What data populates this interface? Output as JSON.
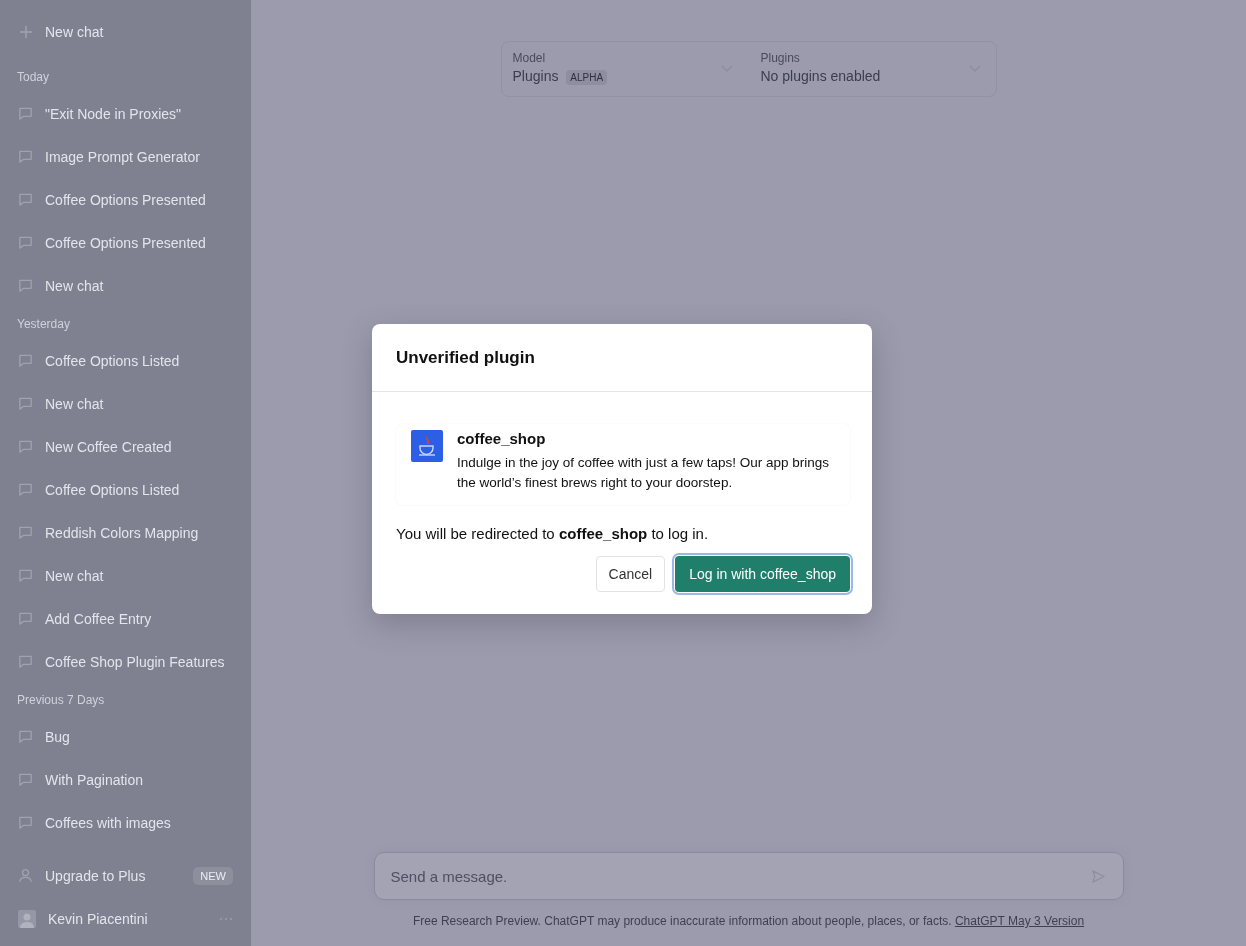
{
  "sidebar": {
    "new_chat": "New chat",
    "sections": [
      {
        "heading": "Today",
        "items": [
          {
            "title": "\"Exit Node in Proxies\""
          },
          {
            "title": "Image Prompt Generator"
          },
          {
            "title": "Coffee Options Presented"
          },
          {
            "title": "Coffee Options Presented"
          },
          {
            "title": "New chat"
          }
        ]
      },
      {
        "heading": "Yesterday",
        "items": [
          {
            "title": "Coffee Options Listed"
          },
          {
            "title": "New chat"
          },
          {
            "title": "New Coffee Created"
          },
          {
            "title": "Coffee Options Listed"
          },
          {
            "title": "Reddish Colors Mapping"
          },
          {
            "title": "New chat"
          },
          {
            "title": "Add Coffee Entry"
          },
          {
            "title": "Coffee Shop Plugin Features"
          }
        ]
      },
      {
        "heading": "Previous 7 Days",
        "items": [
          {
            "title": "Bug"
          },
          {
            "title": "With Pagination"
          },
          {
            "title": "Coffees with images"
          }
        ]
      }
    ],
    "upgrade": {
      "label": "Upgrade to Plus",
      "badge": "NEW"
    },
    "user": {
      "name": "Kevin Piacentini"
    }
  },
  "header": {
    "model": {
      "label": "Model",
      "value": "Plugins",
      "badge": "ALPHA"
    },
    "plugins": {
      "label": "Plugins",
      "value": "No plugins enabled"
    }
  },
  "composer": {
    "placeholder": "Send a message."
  },
  "footer": {
    "text": "Free Research Preview. ChatGPT may produce inaccurate information about people, places, or facts.",
    "link": "ChatGPT May 3 Version"
  },
  "dialog": {
    "title": "Unverified plugin",
    "plugin": {
      "name": "coffee_shop",
      "description": "Indulge in the joy of coffee with just a few taps! Our app brings the world’s finest brews right to your doorstep."
    },
    "message": "You will be redirected to **coffee_shop** to log in.",
    "buttons": [
      {
        "label": "Cancel",
        "kind": "secondary"
      },
      {
        "label": "Log in with coffee_shop",
        "kind": "primary"
      }
    ]
  }
}
